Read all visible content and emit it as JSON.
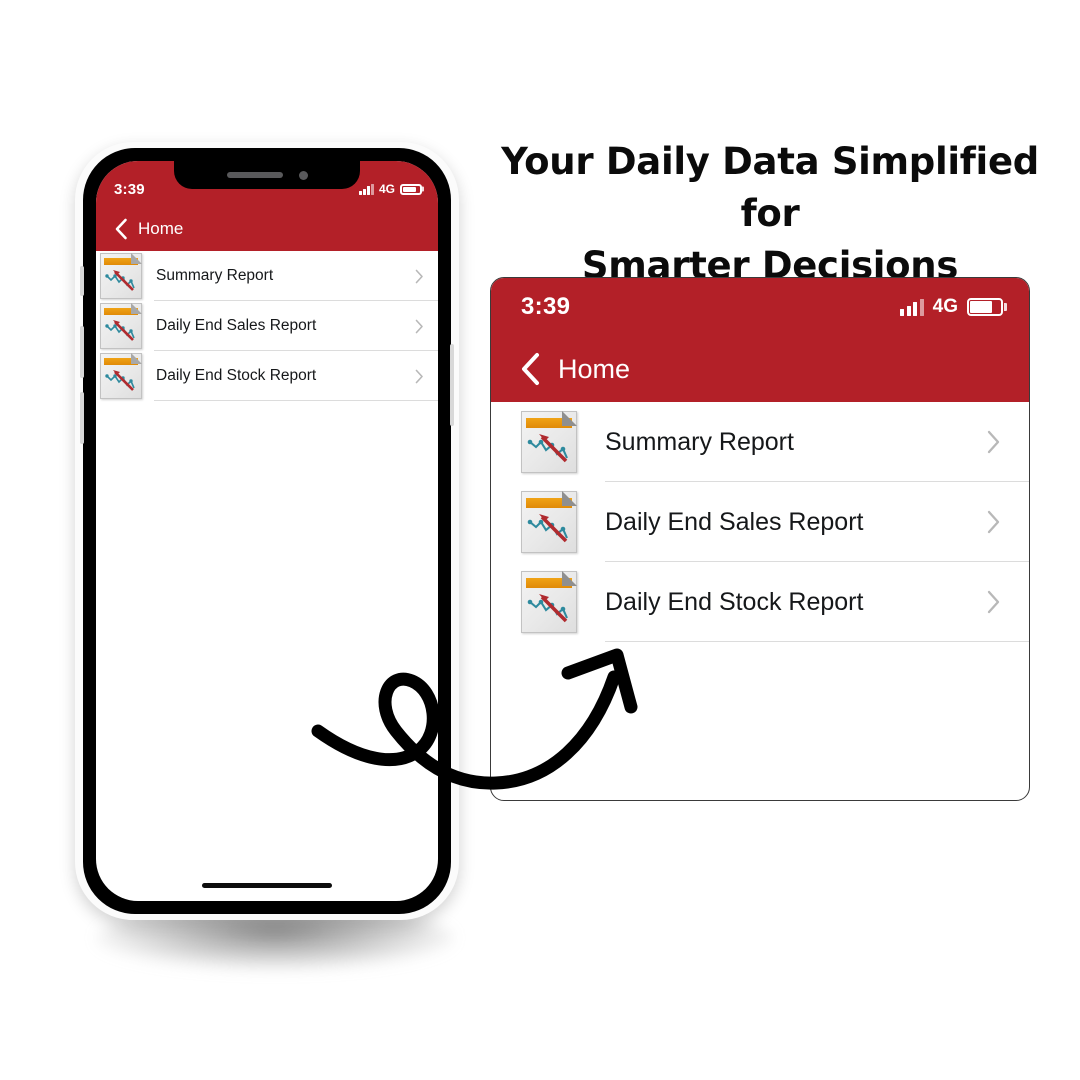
{
  "theme": {
    "brand_red": "#b32028",
    "text_dark": "#16181a",
    "chevron_gray": "#b8b8b8",
    "separator_gray": "#dcdcdc",
    "icon_orange": "#e08a08",
    "icon_arrow_red": "#b02b2f",
    "icon_chart_teal": "#2e8a9e"
  },
  "headline": {
    "line1": "Your Daily Data Simplified for",
    "line2": "Smarter Decisions"
  },
  "app": {
    "status_bar": {
      "time": "3:39",
      "network_type": "4G",
      "signal_icon": "signal-bars-icon",
      "battery_icon": "battery-icon",
      "battery_level": "70"
    },
    "nav_bar": {
      "back_icon": "chevron-left-icon",
      "title": "Home"
    },
    "reports": [
      {
        "label": "Summary Report",
        "icon": "report-document-icon",
        "chevron": "chevron-right-icon"
      },
      {
        "label": "Daily End Sales Report",
        "icon": "report-document-icon",
        "chevron": "chevron-right-icon"
      },
      {
        "label": "Daily End Stock Report",
        "icon": "report-document-icon",
        "chevron": "chevron-right-icon"
      }
    ]
  },
  "decorations": {
    "arrow": "curved-loop-arrow-icon",
    "phone_notch_speaker": "speaker-grill-icon",
    "phone_notch_camera": "front-camera-icon",
    "home_indicator": "home-indicator-bar"
  }
}
